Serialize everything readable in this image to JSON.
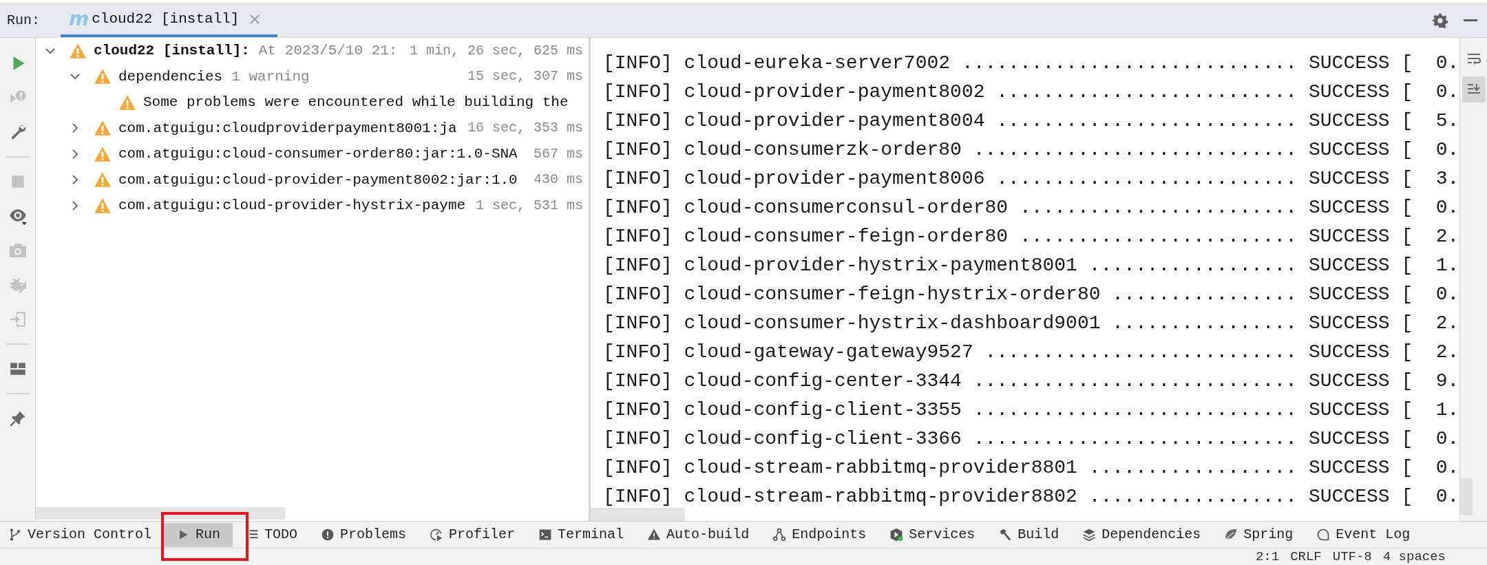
{
  "run_bar": {
    "label": "Run:",
    "tab": {
      "icon_text": "m",
      "label": "cloud22 [install]",
      "selected": true
    }
  },
  "left_toolbar": [
    [
      {
        "disabled": false
      },
      {
        "disabled": true
      },
      {
        "disabled": false
      }
    ],
    [
      {
        "disabled": true
      },
      {
        "disabled": false
      },
      {
        "disabled": true
      },
      {
        "disabled": true
      },
      {
        "disabled": true
      }
    ],
    [
      {
        "disabled": false
      }
    ],
    [
      {
        "disabled": false
      }
    ]
  ],
  "tree": [
    {
      "label": "cloud22 [install]:",
      "note": "At 2023/5/10 21:",
      "time": "1 min, 26 sec, 625 ms",
      "expanded": true,
      "children": [
        {
          "label": "dependencies",
          "note": "1 warning",
          "time": "15 sec, 307 ms",
          "expanded": true,
          "children": [
            {
              "label": "Some problems were encountered while building the"
            }
          ]
        },
        {
          "label": "com.atguigu:cloudproviderpayment8001:ja",
          "time": "16 sec, 353 ms",
          "expanded": false
        },
        {
          "label": "com.atguigu:cloud-consumer-order80:jar:1.0-SNA",
          "time": "567 ms",
          "expanded": false
        },
        {
          "label": "com.atguigu:cloud-provider-payment8002:jar:1.0",
          "time": "430 ms",
          "expanded": false
        },
        {
          "label": "com.atguigu:cloud-provider-hystrix-payme",
          "time": "1 sec, 531 ms",
          "expanded": false
        }
      ]
    }
  ],
  "console": {
    "lines": [
      "[INFO] cloud-eureka-server7002 ............................. SUCCESS [  0.",
      "[INFO] cloud-provider-payment8002 .......................... SUCCESS [  0.",
      "[INFO] cloud-provider-payment8004 .......................... SUCCESS [  5.",
      "[INFO] cloud-consumerzk-order80 ............................ SUCCESS [  0.",
      "[INFO] cloud-provider-payment8006 .......................... SUCCESS [  3.",
      "[INFO] cloud-consumerconsul-order80 ........................ SUCCESS [  0.",
      "[INFO] cloud-consumer-feign-order80 ........................ SUCCESS [  2.",
      "[INFO] cloud-provider-hystrix-payment8001 .................. SUCCESS [  1.",
      "[INFO] cloud-consumer-feign-hystrix-order80 ................ SUCCESS [  0.",
      "[INFO] cloud-consumer-hystrix-dashboard9001 ................ SUCCESS [  2.",
      "[INFO] cloud-gateway-gateway9527 ........................... SUCCESS [  2.",
      "[INFO] cloud-config-center-3344 ............................ SUCCESS [  9.",
      "[INFO] cloud-config-client-3355 ............................ SUCCESS [  1.",
      "[INFO] cloud-config-client-3366 ............................ SUCCESS [  0.",
      "[INFO] cloud-stream-rabbitmq-provider8801 .................. SUCCESS [  0.",
      "[INFO] cloud-stream-rabbitmq-provider8802 .................. SUCCESS [  0."
    ],
    "toolbar": [
      {
        "on": false
      },
      {
        "on": true
      }
    ]
  },
  "tool_windows": [
    {
      "label": "Version Control",
      "selected": false
    },
    {
      "label": "Run",
      "selected": true
    },
    {
      "label": "TODO",
      "selected": false
    },
    {
      "label": "Problems",
      "selected": false
    },
    {
      "label": "Profiler",
      "selected": false
    },
    {
      "label": "Terminal",
      "selected": false
    },
    {
      "label": "Auto-build",
      "selected": false
    },
    {
      "label": "Endpoints",
      "selected": false
    },
    {
      "label": "Services",
      "selected": false
    },
    {
      "label": "Build",
      "selected": false
    },
    {
      "label": "Dependencies",
      "selected": false
    },
    {
      "label": "Spring",
      "selected": false
    },
    {
      "label": "Event Log",
      "selected": false
    }
  ],
  "status_bar": [
    "2:1",
    "CRLF",
    "UTF-8",
    "4 spaces"
  ]
}
